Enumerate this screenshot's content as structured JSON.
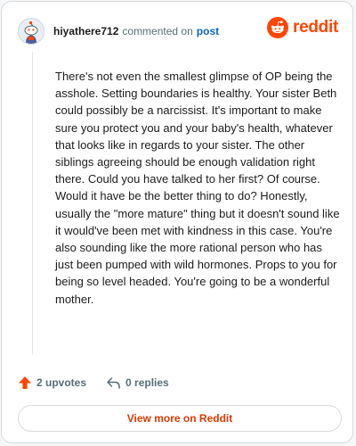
{
  "header": {
    "username": "hiyathere712",
    "action_text": "commented on",
    "post_link": "post",
    "avatar_icon": "snoo-avatar-icon",
    "logo_icon": "reddit-logo-icon",
    "logo_text": "reddit"
  },
  "comment": {
    "body": "There's not even the smallest glimpse of OP being the asshole. Setting boundaries is healthy. Your sister Beth could possibly be a narcissist. It's important to make sure you protect you and your baby's health, whatever that looks like in regards to your sister. The other siblings agreeing should be enough validation right there. Could you have talked to her first? Of course. Would it have be the better thing to do? Honestly, usually the \"more mature\" thing but it doesn't sound like it would've been met with kindness in this case. You're also sounding like the more rational person who has just been pumped with wild hormones. Props to you for being so level headed. You're going to be a wonderful mother."
  },
  "actions": {
    "upvotes": "2 upvotes",
    "upvote_icon": "upvote-arrow-icon",
    "replies": "0 replies",
    "reply_icon": "reply-arrow-icon"
  },
  "footer": {
    "view_more": "View more on Reddit"
  },
  "colors": {
    "brand": "#ff4500",
    "link": "#0a66c2",
    "muted": "#576f76",
    "button_text": "#d93a00",
    "border": "#d9dadb"
  }
}
